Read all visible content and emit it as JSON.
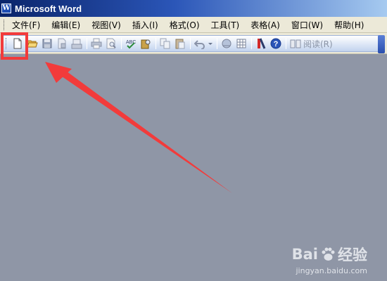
{
  "window": {
    "title": "Microsoft Word",
    "app_icon_letter": "W"
  },
  "menubar": {
    "items": [
      "文件(F)",
      "编辑(E)",
      "视图(V)",
      "插入(I)",
      "格式(O)",
      "工具(T)",
      "表格(A)",
      "窗口(W)",
      "帮助(H)"
    ]
  },
  "toolbar": {
    "buttons": [
      "new-document",
      "open",
      "save",
      "permission",
      "email",
      "print",
      "print-preview",
      "spelling",
      "research",
      "copy",
      "paste",
      "undo",
      "undo-dropdown",
      "insert-hyperlink",
      "tables-and-borders",
      "show-hide",
      "help"
    ],
    "read_label": "阅读(R)"
  },
  "annotation": {
    "color": "#f23b3b"
  },
  "watermark": {
    "brand_left": "Bai",
    "brand_right": "经验",
    "url": "jingyan.baidu.com"
  }
}
